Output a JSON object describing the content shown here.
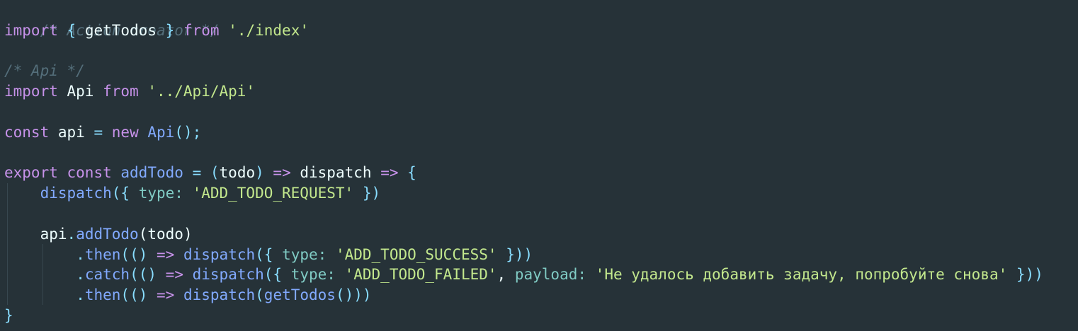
{
  "editor": {
    "theme_colors": {
      "background": "#263238",
      "comment": "#546e7a",
      "keyword": "#c792ea",
      "string": "#c3e88d",
      "function": "#82aaff",
      "punctuation": "#89ddff",
      "text": "#eeffff"
    },
    "lines": {
      "l1": {
        "comment": "/* Action creator */"
      },
      "l2": {
        "kw_import": "import",
        "brace_open": "{",
        "name": "getTodos",
        "brace_close": "}",
        "kw_from": "from",
        "path": "'./index'"
      },
      "l4": {
        "comment": "/* Api */"
      },
      "l5": {
        "kw_import": "import",
        "name": "Api",
        "kw_from": "from",
        "path": "'../Api/Api'"
      },
      "l7": {
        "kw_const": "const",
        "name": "api",
        "eq": "=",
        "kw_new": "new",
        "cls": "Api",
        "call": "();"
      },
      "l9": {
        "kw_export": "export",
        "kw_const": "const",
        "name": "addTodo",
        "eq": "=",
        "p_open": "(",
        "param": "todo",
        "p_close": ")",
        "arrow1": "=>",
        "param2": "dispatch",
        "arrow2": "=>",
        "brace": "{"
      },
      "l10": {
        "fn": "dispatch",
        "open": "({",
        "key": "type:",
        "val": "'ADD_TODO_REQUEST'",
        "close": "})"
      },
      "l12": {
        "obj": "api",
        "dot": ".",
        "method": "addTodo",
        "p_open": "(",
        "arg": "todo",
        "p_close": ")"
      },
      "l13": {
        "dot": ".",
        "method": "then",
        "open": "((",
        "close1": ")",
        "arrow": "=>",
        "fn": "dispatch",
        "open2": "({",
        "key": "type:",
        "val": "'ADD_TODO_SUCCESS'",
        "close": "}))"
      },
      "l14": {
        "dot": ".",
        "method": "catch",
        "open": "((",
        "close1": ")",
        "arrow": "=>",
        "fn": "dispatch",
        "open2": "({",
        "key": "type:",
        "val": "'ADD_TODO_FAILED'",
        "comma": ",",
        "key2": "payload:",
        "val2": "'Не удалось добавить задачу, попробуйте снова'",
        "close": "}))"
      },
      "l15": {
        "dot": ".",
        "method": "then",
        "open": "((",
        "close1": ")",
        "arrow": "=>",
        "fn": "dispatch",
        "open2": "(",
        "fn2": "getTodos",
        "call": "()",
        "close": "))"
      },
      "l16": {
        "brace": "}"
      }
    }
  }
}
